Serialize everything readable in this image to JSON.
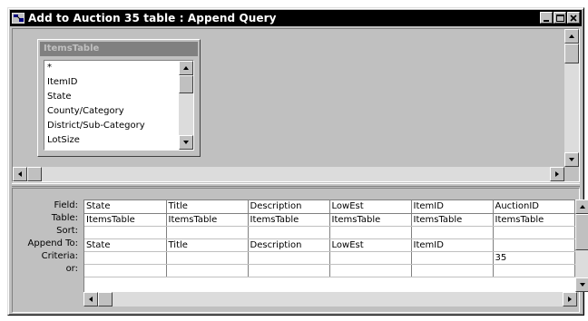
{
  "window": {
    "title": "Add to Auction 35 table : Append Query"
  },
  "field_list": {
    "table_name": "ItemsTable",
    "items": [
      "*",
      "ItemID",
      "State",
      "County/Category",
      "District/Sub-Category",
      "LotSize"
    ]
  },
  "grid": {
    "row_labels": [
      "Field:",
      "Table:",
      "Sort:",
      "Append To:",
      "Criteria:",
      "or:"
    ],
    "columns": [
      {
        "field": "State",
        "table": "ItemsTable",
        "sort": "",
        "append_to": "State",
        "criteria": "",
        "or": ""
      },
      {
        "field": "Title",
        "table": "ItemsTable",
        "sort": "",
        "append_to": "Title",
        "criteria": "",
        "or": ""
      },
      {
        "field": "Description",
        "table": "ItemsTable",
        "sort": "",
        "append_to": "Description",
        "criteria": "",
        "or": ""
      },
      {
        "field": "LowEst",
        "table": "ItemsTable",
        "sort": "",
        "append_to": "LowEst",
        "criteria": "",
        "or": ""
      },
      {
        "field": "ItemID",
        "table": "ItemsTable",
        "sort": "",
        "append_to": "ItemID",
        "criteria": "",
        "or": ""
      },
      {
        "field": "AuctionID",
        "table": "ItemsTable",
        "sort": "",
        "append_to": "",
        "criteria": "35",
        "or": ""
      }
    ]
  },
  "icons": {
    "app": "query-icon",
    "minimize": "minimize-icon",
    "maximize": "maximize-icon",
    "close": "close-icon",
    "scroll_up": "arrow-up-icon",
    "scroll_down": "arrow-down-icon",
    "scroll_left": "arrow-left-icon",
    "scroll_right": "arrow-right-icon"
  },
  "colors": {
    "face": "#c0c0c0",
    "titlebar": "#000000",
    "field_list_title": "#808080"
  }
}
